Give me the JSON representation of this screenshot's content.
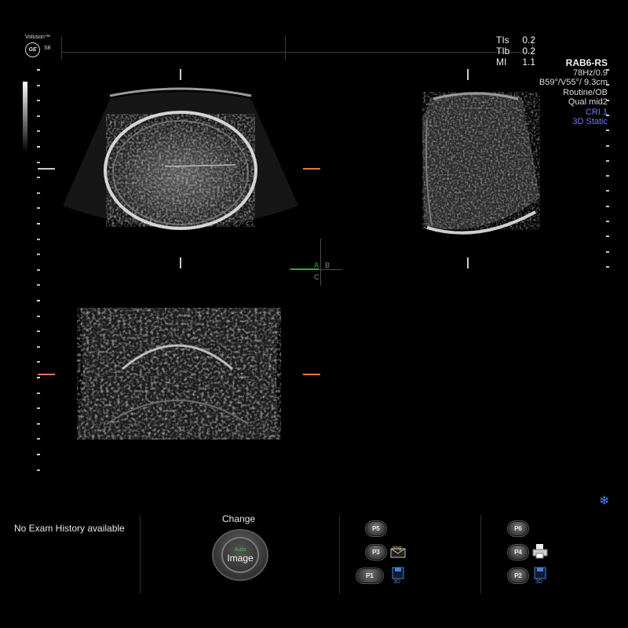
{
  "brand": {
    "name": "Voluson™",
    "logo": "GE",
    "model": "S8"
  },
  "indices": [
    {
      "label": "TIs",
      "value": "0.2"
    },
    {
      "label": "TIb",
      "value": "0.2"
    },
    {
      "label": "MI",
      "value": "1.1"
    }
  ],
  "probe": {
    "name": "RAB6-RS",
    "freq": "78Hz/0.9",
    "angle": "B59°/V55°/ 9.3cm",
    "preset": "Routine/OB",
    "quality": "Qual mid2",
    "cri": "CRI 1",
    "mode": "3D Static"
  },
  "plane_labels": {
    "a": "A",
    "b": "B",
    "c": "C"
  },
  "bottom": {
    "exam_history": "No Exam History available",
    "change_label": "Change",
    "knob_sub": "Auto",
    "knob_main": "Image",
    "buttons": {
      "p1": "P1",
      "p2": "P2",
      "p3": "P3",
      "p4": "P4",
      "p5": "P5",
      "p6": "P6"
    },
    "img_label": "Img",
    "threed_label": "3D"
  },
  "icons": {
    "freeze": "snowflake-icon",
    "save": "floppy-disk-icon",
    "print": "printer-icon",
    "envelope": "envelope-icon"
  },
  "colors": {
    "accent_blue": "#6d7cf2",
    "freeze_blue": "#4b7ef0",
    "knob_green": "#3ec43e",
    "marker_orange": "#e07a3a",
    "plane_green": "#3fa53f"
  }
}
